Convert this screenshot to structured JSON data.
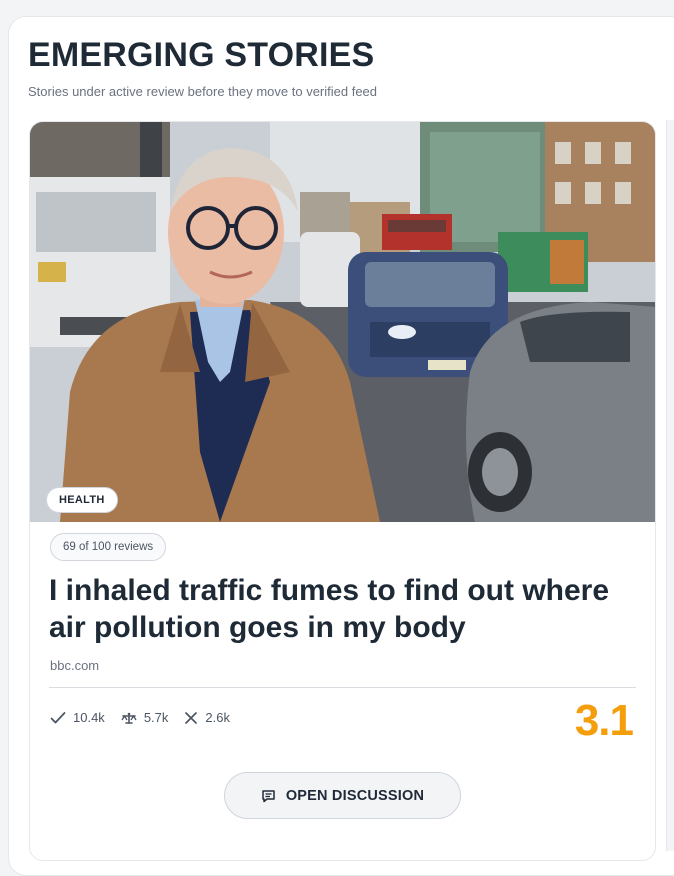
{
  "section": {
    "title": "EMERGING STORIES",
    "subtitle": "Stories under active review before they move to verified feed"
  },
  "card": {
    "category": "HEALTH",
    "reviews": "69 of 100 reviews",
    "headline": "I inhaled traffic fumes to find out where air pollution goes in my body",
    "source": "bbc.com",
    "stats": {
      "verified": "10.4k",
      "neutral": "5.7k",
      "rejected": "2.6k"
    },
    "score": "3.1",
    "discussion_label": "OPEN DISCUSSION",
    "image_description_icon": "photo"
  },
  "colors": {
    "score": "#f59e0b",
    "title": "#1f2a37",
    "muted": "#6b7280"
  }
}
